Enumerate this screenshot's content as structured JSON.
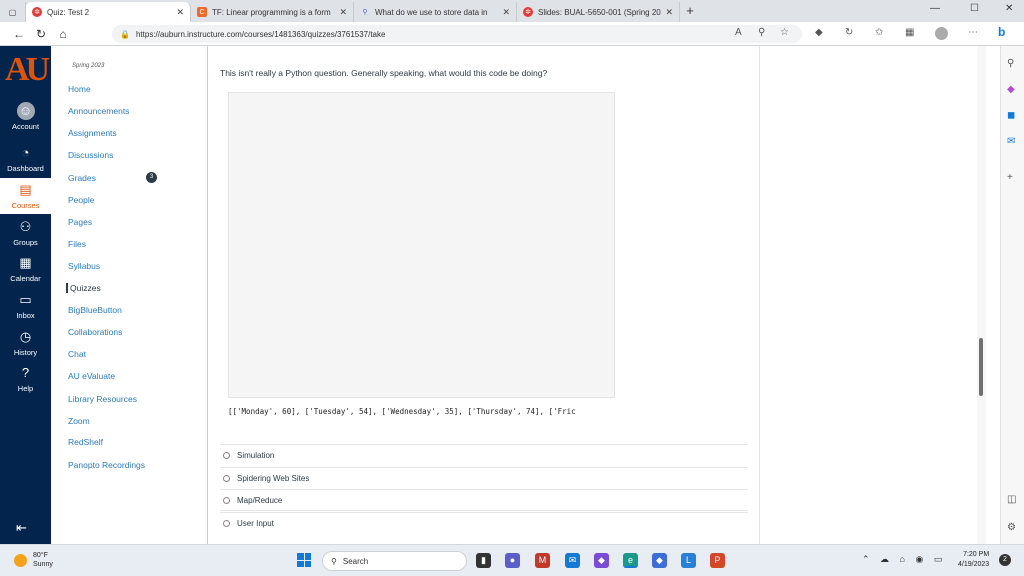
{
  "browser": {
    "tabs": [
      {
        "title": "Quiz: Test 2",
        "active": true,
        "icon_color": "#e23b3b",
        "icon": "canvas-icon"
      },
      {
        "title": "TF: Linear programming is a form",
        "active": false,
        "icon_color": "#e86a2d",
        "icon": "chegg-icon"
      },
      {
        "title": "What do we use to store data in",
        "active": false,
        "icon_color": "#4a6fd8",
        "icon": "search-icon"
      },
      {
        "title": "Slides: BUAL-5650-001 (Spring 20",
        "active": false,
        "icon_color": "#e23b3b",
        "icon": "canvas-icon"
      }
    ],
    "url": "https://auburn.instructure.com/courses/1481363/quizzes/3761537/take"
  },
  "global_nav": {
    "items": [
      {
        "label": "Account",
        "icon": "account-icon"
      },
      {
        "label": "Dashboard",
        "icon": "dashboard-icon"
      },
      {
        "label": "Courses",
        "icon": "courses-icon"
      },
      {
        "label": "Groups",
        "icon": "groups-icon"
      },
      {
        "label": "Calendar",
        "icon": "calendar-icon"
      },
      {
        "label": "Inbox",
        "icon": "inbox-icon"
      },
      {
        "label": "History",
        "icon": "history-icon"
      },
      {
        "label": "Help",
        "icon": "help-icon"
      }
    ],
    "active": "Courses"
  },
  "course_nav": {
    "term": "Spring 2023",
    "items": [
      "Home",
      "Announcements",
      "Assignments",
      "Discussions",
      "Grades",
      "People",
      "Pages",
      "Files",
      "Syllabus",
      "Quizzes",
      "BigBlueButton",
      "Collaborations",
      "Chat",
      "AU eValuate",
      "Library Resources",
      "Zoom",
      "RedShelf",
      "Panopto Recordings"
    ],
    "active": "Quizzes",
    "grades_badge": "3"
  },
  "question": {
    "text": "This isn't really a Python question. Generally speaking, what would this code be doing?",
    "output": "[['Monday', 60], ['Tuesday', 54], ['Wednesday', 35], ['Thursday', 74], ['Fric",
    "options": [
      "Simulation",
      "Spidering Web Sites",
      "Map/Reduce",
      "User Input"
    ]
  },
  "taskbar": {
    "temp": "80°F",
    "condition": "Sunny",
    "search_placeholder": "Search",
    "time": "7:20 PM",
    "date": "4/19/2023",
    "notifications": "2"
  }
}
